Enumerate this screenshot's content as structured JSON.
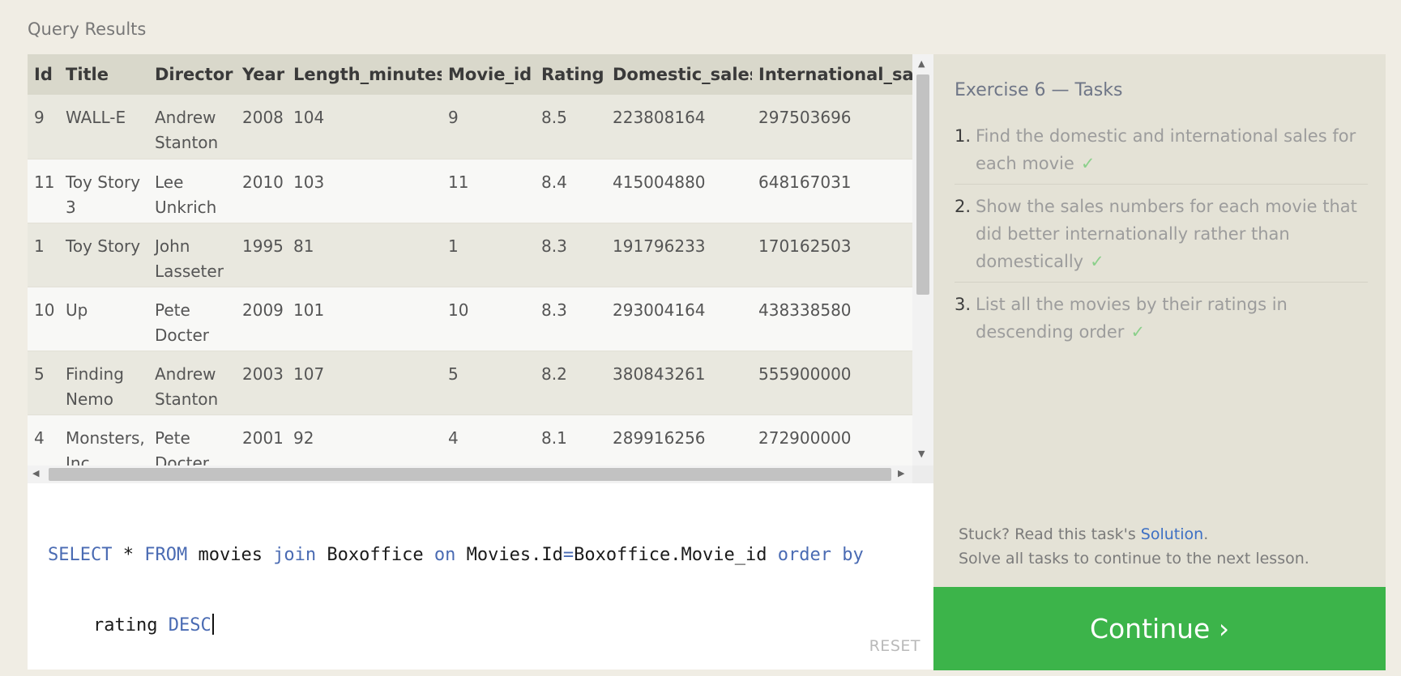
{
  "results_label": "Query Results",
  "table": {
    "columns": [
      "Id",
      "Title",
      "Director",
      "Year",
      "Length_minutes",
      "Movie_id",
      "Rating",
      "Domestic_sales",
      "International_sa"
    ],
    "rows": [
      [
        "9",
        "WALL-E",
        "Andrew Stanton",
        "2008",
        "104",
        "9",
        "8.5",
        "223808164",
        "297503696"
      ],
      [
        "11",
        "Toy Story 3",
        "Lee Unkrich",
        "2010",
        "103",
        "11",
        "8.4",
        "415004880",
        "648167031"
      ],
      [
        "1",
        "Toy Story",
        "John Lasseter",
        "1995",
        "81",
        "1",
        "8.3",
        "191796233",
        "170162503"
      ],
      [
        "10",
        "Up",
        "Pete Docter",
        "2009",
        "101",
        "10",
        "8.3",
        "293004164",
        "438338580"
      ],
      [
        "5",
        "Finding Nemo",
        "Andrew Stanton",
        "2003",
        "107",
        "5",
        "8.2",
        "380843261",
        "555900000"
      ],
      [
        "4",
        "Monsters, Inc.",
        "Pete Docter",
        "2001",
        "92",
        "4",
        "8.1",
        "289916256",
        "272900000"
      ]
    ]
  },
  "editor": {
    "line1": [
      {
        "text": "SELECT",
        "kw": true
      },
      {
        "text": " * ",
        "kw": false
      },
      {
        "text": "FROM",
        "kw": true
      },
      {
        "text": " movies ",
        "kw": false
      },
      {
        "text": "join",
        "kw": true
      },
      {
        "text": " Boxoffice ",
        "kw": false
      },
      {
        "text": "on",
        "kw": true
      },
      {
        "text": " Movies.Id",
        "kw": false
      },
      {
        "text": "=",
        "kw": true
      },
      {
        "text": "Boxoffice.Movie_id ",
        "kw": false
      },
      {
        "text": "order",
        "kw": true
      },
      {
        "text": " ",
        "kw": false
      },
      {
        "text": "by",
        "kw": true
      }
    ],
    "line2": [
      {
        "text": "rating ",
        "kw": false
      },
      {
        "text": "DESC",
        "kw": true
      }
    ],
    "reset_label": "RESET"
  },
  "tasks": {
    "title": "Exercise 6 — Tasks",
    "items": [
      {
        "num": "1.",
        "text": "Find the domestic and international sales for each movie",
        "check": "✓"
      },
      {
        "num": "2.",
        "text": "Show the sales numbers for each movie that did better internationally rather than domestically",
        "check": "✓"
      },
      {
        "num": "3.",
        "text": "List all the movies by their ratings in descending order",
        "check": "✓"
      }
    ],
    "stuck_prefix": "Stuck? Read this task's ",
    "solution_link": "Solution",
    "stuck_suffix": ".",
    "solve_all": "Solve all tasks to continue to the next lesson."
  },
  "continue_label": "Continue ›",
  "colors": {
    "keyword": "#4a6bb3",
    "continue_bg": "#3cb44a",
    "link": "#3c6fc4",
    "check": "#8bd08b"
  }
}
